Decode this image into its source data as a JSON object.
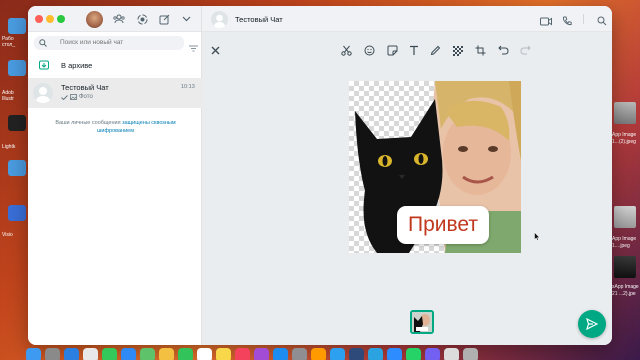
{
  "desktop": {
    "left_labels": [
      "Рабо",
      "стол_",
      "Adob",
      "Illustr",
      "Lightk",
      "Visio"
    ],
    "right_labels": [
      "App Image",
      "1...(2).jpeg",
      "App Image",
      "1....jpeg",
      "sApp Image",
      "21 ...2).jpe"
    ]
  },
  "sidebar": {
    "search_placeholder": "Поиск или новый чат",
    "archive_label": "В архиве",
    "chat": {
      "name": "Тестовый Чат",
      "time": "10:13",
      "preview": "Фото"
    },
    "encryption_note_prefix": "Ваши личные сообщения ",
    "encryption_link": "защищены сквозным шифрованием"
  },
  "main": {
    "title": "Тестовый Чат",
    "sticker_text": "Привет"
  },
  "icons": {
    "header": [
      "community-icon",
      "status-icon",
      "new-chat-icon",
      "chevron-down-icon"
    ],
    "main_header": [
      "video-call-icon",
      "phone-icon",
      "search-icon",
      "chevron-down-icon"
    ],
    "toolbar": [
      "close-icon",
      "scissors-icon",
      "emoji-icon",
      "sticker-icon",
      "text-icon",
      "pen-icon",
      "blur-icon",
      "crop-icon",
      "undo-icon",
      "redo-icon"
    ]
  },
  "colors": {
    "accent": "#00a884",
    "link": "#027eb5",
    "sticker_text": "#c0391f"
  }
}
